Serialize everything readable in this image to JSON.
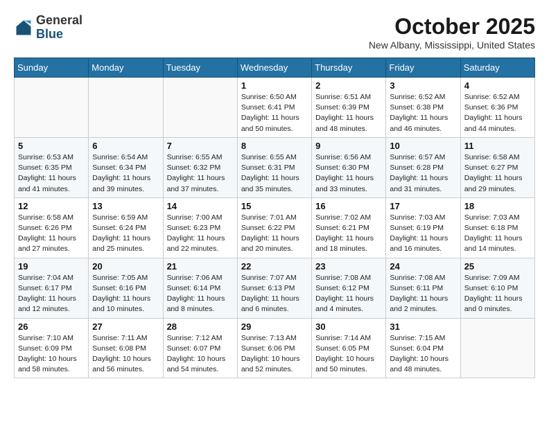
{
  "header": {
    "logo_general": "General",
    "logo_blue": "Blue",
    "month_title": "October 2025",
    "location": "New Albany, Mississippi, United States"
  },
  "calendar": {
    "weekdays": [
      "Sunday",
      "Monday",
      "Tuesday",
      "Wednesday",
      "Thursday",
      "Friday",
      "Saturday"
    ],
    "weeks": [
      [
        {
          "day": "",
          "info": ""
        },
        {
          "day": "",
          "info": ""
        },
        {
          "day": "",
          "info": ""
        },
        {
          "day": "1",
          "info": "Sunrise: 6:50 AM\nSunset: 6:41 PM\nDaylight: 11 hours\nand 50 minutes."
        },
        {
          "day": "2",
          "info": "Sunrise: 6:51 AM\nSunset: 6:39 PM\nDaylight: 11 hours\nand 48 minutes."
        },
        {
          "day": "3",
          "info": "Sunrise: 6:52 AM\nSunset: 6:38 PM\nDaylight: 11 hours\nand 46 minutes."
        },
        {
          "day": "4",
          "info": "Sunrise: 6:52 AM\nSunset: 6:36 PM\nDaylight: 11 hours\nand 44 minutes."
        }
      ],
      [
        {
          "day": "5",
          "info": "Sunrise: 6:53 AM\nSunset: 6:35 PM\nDaylight: 11 hours\nand 41 minutes."
        },
        {
          "day": "6",
          "info": "Sunrise: 6:54 AM\nSunset: 6:34 PM\nDaylight: 11 hours\nand 39 minutes."
        },
        {
          "day": "7",
          "info": "Sunrise: 6:55 AM\nSunset: 6:32 PM\nDaylight: 11 hours\nand 37 minutes."
        },
        {
          "day": "8",
          "info": "Sunrise: 6:55 AM\nSunset: 6:31 PM\nDaylight: 11 hours\nand 35 minutes."
        },
        {
          "day": "9",
          "info": "Sunrise: 6:56 AM\nSunset: 6:30 PM\nDaylight: 11 hours\nand 33 minutes."
        },
        {
          "day": "10",
          "info": "Sunrise: 6:57 AM\nSunset: 6:28 PM\nDaylight: 11 hours\nand 31 minutes."
        },
        {
          "day": "11",
          "info": "Sunrise: 6:58 AM\nSunset: 6:27 PM\nDaylight: 11 hours\nand 29 minutes."
        }
      ],
      [
        {
          "day": "12",
          "info": "Sunrise: 6:58 AM\nSunset: 6:26 PM\nDaylight: 11 hours\nand 27 minutes."
        },
        {
          "day": "13",
          "info": "Sunrise: 6:59 AM\nSunset: 6:24 PM\nDaylight: 11 hours\nand 25 minutes."
        },
        {
          "day": "14",
          "info": "Sunrise: 7:00 AM\nSunset: 6:23 PM\nDaylight: 11 hours\nand 22 minutes."
        },
        {
          "day": "15",
          "info": "Sunrise: 7:01 AM\nSunset: 6:22 PM\nDaylight: 11 hours\nand 20 minutes."
        },
        {
          "day": "16",
          "info": "Sunrise: 7:02 AM\nSunset: 6:21 PM\nDaylight: 11 hours\nand 18 minutes."
        },
        {
          "day": "17",
          "info": "Sunrise: 7:03 AM\nSunset: 6:19 PM\nDaylight: 11 hours\nand 16 minutes."
        },
        {
          "day": "18",
          "info": "Sunrise: 7:03 AM\nSunset: 6:18 PM\nDaylight: 11 hours\nand 14 minutes."
        }
      ],
      [
        {
          "day": "19",
          "info": "Sunrise: 7:04 AM\nSunset: 6:17 PM\nDaylight: 11 hours\nand 12 minutes."
        },
        {
          "day": "20",
          "info": "Sunrise: 7:05 AM\nSunset: 6:16 PM\nDaylight: 11 hours\nand 10 minutes."
        },
        {
          "day": "21",
          "info": "Sunrise: 7:06 AM\nSunset: 6:14 PM\nDaylight: 11 hours\nand 8 minutes."
        },
        {
          "day": "22",
          "info": "Sunrise: 7:07 AM\nSunset: 6:13 PM\nDaylight: 11 hours\nand 6 minutes."
        },
        {
          "day": "23",
          "info": "Sunrise: 7:08 AM\nSunset: 6:12 PM\nDaylight: 11 hours\nand 4 minutes."
        },
        {
          "day": "24",
          "info": "Sunrise: 7:08 AM\nSunset: 6:11 PM\nDaylight: 11 hours\nand 2 minutes."
        },
        {
          "day": "25",
          "info": "Sunrise: 7:09 AM\nSunset: 6:10 PM\nDaylight: 11 hours\nand 0 minutes."
        }
      ],
      [
        {
          "day": "26",
          "info": "Sunrise: 7:10 AM\nSunset: 6:09 PM\nDaylight: 10 hours\nand 58 minutes."
        },
        {
          "day": "27",
          "info": "Sunrise: 7:11 AM\nSunset: 6:08 PM\nDaylight: 10 hours\nand 56 minutes."
        },
        {
          "day": "28",
          "info": "Sunrise: 7:12 AM\nSunset: 6:07 PM\nDaylight: 10 hours\nand 54 minutes."
        },
        {
          "day": "29",
          "info": "Sunrise: 7:13 AM\nSunset: 6:06 PM\nDaylight: 10 hours\nand 52 minutes."
        },
        {
          "day": "30",
          "info": "Sunrise: 7:14 AM\nSunset: 6:05 PM\nDaylight: 10 hours\nand 50 minutes."
        },
        {
          "day": "31",
          "info": "Sunrise: 7:15 AM\nSunset: 6:04 PM\nDaylight: 10 hours\nand 48 minutes."
        },
        {
          "day": "",
          "info": ""
        }
      ]
    ]
  }
}
